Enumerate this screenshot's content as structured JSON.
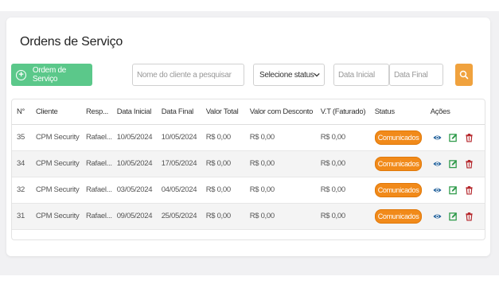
{
  "page": {
    "title": "Ordens de Serviço"
  },
  "toolbar": {
    "new_button_label": "Ordem de Serviço",
    "search_placeholder": "Nome do cliente a pesquisar",
    "status_select_value": "Selecione status",
    "date_start_placeholder": "Data Inicial",
    "date_end_placeholder": "Data Final"
  },
  "table": {
    "headers": [
      "N°",
      "Cliente",
      "Resp...",
      "Data Inicial",
      "Data Final",
      "Valor Total",
      "Valor com Desconto",
      "V.T (Faturado)",
      "Status",
      "Ações"
    ],
    "rows": [
      {
        "num": "35",
        "cliente": "CPM Security",
        "resp": "Rafael...",
        "data_inicial": "10/05/2024",
        "data_final": "10/05/2024",
        "valor_total": "R$ 0,00",
        "valor_desconto": "R$ 0,00",
        "vt_faturado": "R$ 0,00",
        "status": "Comunicados"
      },
      {
        "num": "34",
        "cliente": "CPM Security",
        "resp": "Rafael...",
        "data_inicial": "10/05/2024",
        "data_final": "17/05/2024",
        "valor_total": "R$ 0,00",
        "valor_desconto": "R$ 0,00",
        "vt_faturado": "R$ 0,00",
        "status": "Comunicados"
      },
      {
        "num": "32",
        "cliente": "CPM Security",
        "resp": "Rafael...",
        "data_inicial": "03/05/2024",
        "data_final": "04/05/2024",
        "valor_total": "R$ 0,00",
        "valor_desconto": "R$ 0,00",
        "vt_faturado": "R$ 0,00",
        "status": "Comunicados"
      },
      {
        "num": "31",
        "cliente": "CPM Security",
        "resp": "Rafael...",
        "data_inicial": "09/05/2024",
        "data_final": "25/05/2024",
        "valor_total": "R$ 0,00",
        "valor_desconto": "R$ 0,00",
        "vt_faturado": "R$ 0,00",
        "status": "Comunicados"
      }
    ]
  },
  "icons": {
    "new": "plus-circle-icon",
    "search": "search-icon",
    "view": "eye-icon",
    "edit": "edit-icon",
    "delete": "trash-icon"
  },
  "colors": {
    "primary_green": "#5bc88a",
    "search_orange": "#f0a23e",
    "status_badge": "#f18a1a",
    "view_icon": "#1f5f9a",
    "edit_icon": "#2e9a4a",
    "delete_icon": "#b5262b"
  }
}
